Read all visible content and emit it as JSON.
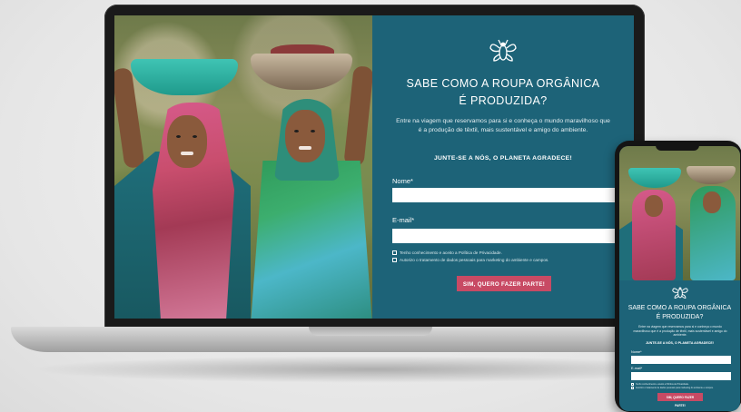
{
  "landing": {
    "logo_icon": "bee-icon",
    "headline_line1": "SABE COMO A ROUPA ORGÂNICA",
    "headline_line2": "É PRODUZIDA?",
    "intro": "Entre na viagem que reservamos para si e conheça o mundo maravilhoso que é a produção de têxtil, mais sustentável e amigo do ambiente.",
    "cta": "JUNTE-SE A NÓS, O PLANETA AGRADECE!",
    "name_label": "Nome*",
    "name_value": "",
    "email_label": "E-mail*",
    "email_value": "",
    "checkbox1": "Tenho conhecimento e aceito a Política de Privacidade.",
    "checkbox2": "Autorizo o tratamento de dados pessoais para marketing do ambiente e campos.",
    "submit": "SIM, QUERO FAZER PARTE!"
  },
  "colors": {
    "panel_bg": "#1d6378",
    "button_bg": "#c84a64",
    "text": "#ffffff"
  }
}
